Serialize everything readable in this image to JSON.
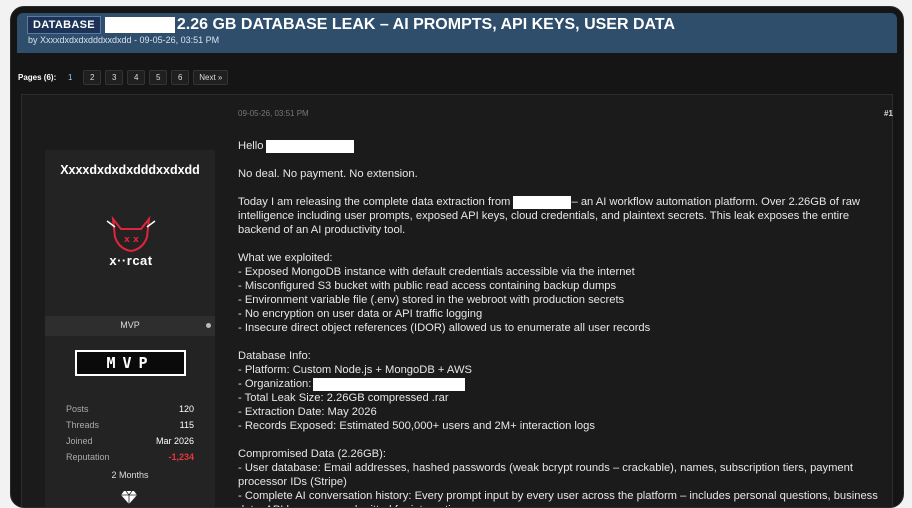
{
  "thread": {
    "badge": "DATABASE",
    "title": "2.26 GB DATABASE LEAK – AI PROMPTS, API KEYS, USER DATA",
    "byline": "by Xxxxdxdxdxdddxxdxdd - 09-05-26, 03:51 PM"
  },
  "pagination": {
    "label": "Pages (6):",
    "pages": [
      "1",
      "2",
      "3",
      "4",
      "5",
      "6"
    ],
    "current": "1",
    "next": "Next »"
  },
  "post": {
    "date": "09-05-26, 03:51 PM",
    "number": "#1",
    "author": {
      "username": "Xxxxdxdxdxdddxxdxdd",
      "avatar_text": "x··rcat",
      "rank": "MVP",
      "rank_badge": "MVP",
      "stats": [
        {
          "label": "Posts",
          "value": "120"
        },
        {
          "label": "Threads",
          "value": "115"
        },
        {
          "label": "Joined",
          "value": "Mar 2026"
        },
        {
          "label": "Reputation",
          "value": "-1,234"
        }
      ],
      "age": "2 Months"
    },
    "greeting": "Hello",
    "l1": "No deal. No payment. No extension.",
    "p2_a": "Today I am releasing the complete data extraction from",
    "p2_b": "– an AI workflow automation platform. Over 2.26GB of raw intelligence including user prompts, exposed API keys, cloud credentials, and plaintext secrets. This leak exposes the entire backend of an AI productivity tool.",
    "exploited_title": "What we exploited:",
    "exploited": [
      "- Exposed MongoDB instance with default credentials accessible via the internet",
      "- Misconfigured S3 bucket with public read access containing backup dumps",
      "- Environment variable file (.env) stored in the webroot with production secrets",
      "- No encryption on user data or API traffic logging",
      "- Insecure direct object references (IDOR) allowed us to enumerate all user records"
    ],
    "db_title": "Database Info:",
    "db_platform": "- Platform: Custom Node.js + MongoDB + AWS",
    "db_org": "- Organization:",
    "db_rest": [
      "- Total Leak Size: 2.26GB compressed .rar",
      "- Extraction Date: May 2026",
      "- Records Exposed: Estimated 500,000+ users and 2M+ interaction logs"
    ],
    "comp_title": "Compromised Data (2.26GB):",
    "comp": [
      "- User database: Email addresses, hashed passwords (weak bcrypt rounds – crackable), names, subscription tiers, payment processor IDs (Stripe)",
      "- Complete AI conversation history: Every prompt input by every user across the platform – includes personal questions, business data, API keys users submitted for integrations"
    ]
  }
}
